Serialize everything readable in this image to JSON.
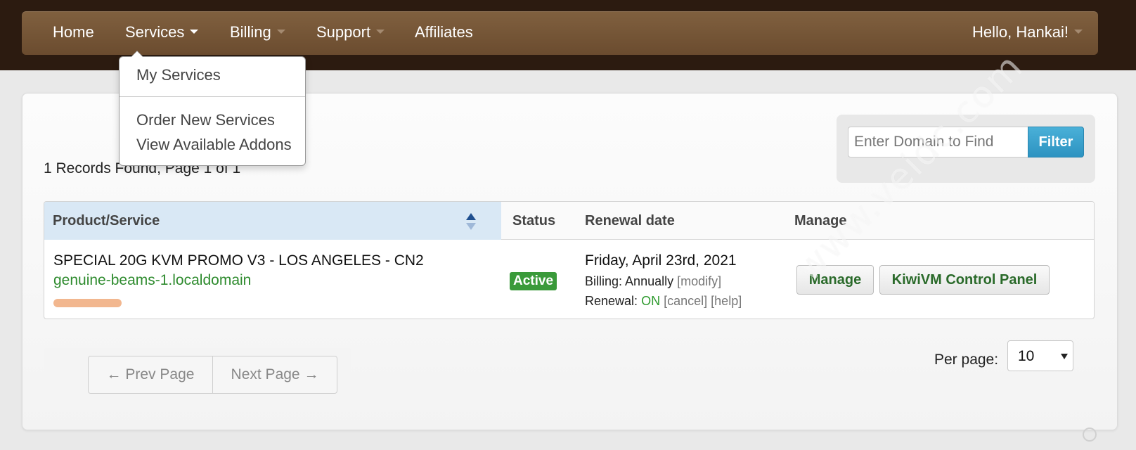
{
  "nav": {
    "items": [
      {
        "label": "Home"
      },
      {
        "label": "Services"
      },
      {
        "label": "Billing"
      },
      {
        "label": "Support"
      },
      {
        "label": "Affiliates"
      }
    ],
    "user_greeting": "Hello, Hankai!"
  },
  "services_dropdown": {
    "items": [
      {
        "label": "My Services"
      },
      {
        "label": "Order New Services"
      },
      {
        "label": "View Available Addons"
      }
    ]
  },
  "records_text": "1 Records Found, Page 1 of 1",
  "filter": {
    "placeholder": "Enter Domain to Find",
    "button_label": "Filter"
  },
  "table": {
    "columns": [
      "Product/Service",
      "Status",
      "Renewal date",
      "Manage"
    ],
    "rows": [
      {
        "product": "SPECIAL 20G KVM PROMO V3 - LOS ANGELES - CN2",
        "domain": "genuine-beams-1.localdomain",
        "status": "Active",
        "renewal_date": "Friday, April 23rd, 2021",
        "billing_label": "Billing:",
        "billing_cycle": "Annually",
        "modify_link": "modify",
        "renewal_label": "Renewal:",
        "renewal_status": "ON",
        "cancel_link": "cancel",
        "help_link": "help",
        "manage_button": "Manage",
        "panel_button": "KiwiVM Control Panel"
      }
    ]
  },
  "pagination": {
    "prev_label": "← Prev Page",
    "next_label": "Next Page →"
  },
  "per_page": {
    "label": "Per page:",
    "value": "10"
  },
  "watermark": "www.veidc.com",
  "colors": {
    "nav_bg": "#74553a",
    "top_band": "#2c1b10",
    "accent_green": "#2e8b2e",
    "filter_blue": "#2d93c1",
    "header_blue": "#d9e8f5"
  },
  "icons": [
    "caret-down-icon",
    "sort-icon",
    "select-arrow-icon"
  ]
}
